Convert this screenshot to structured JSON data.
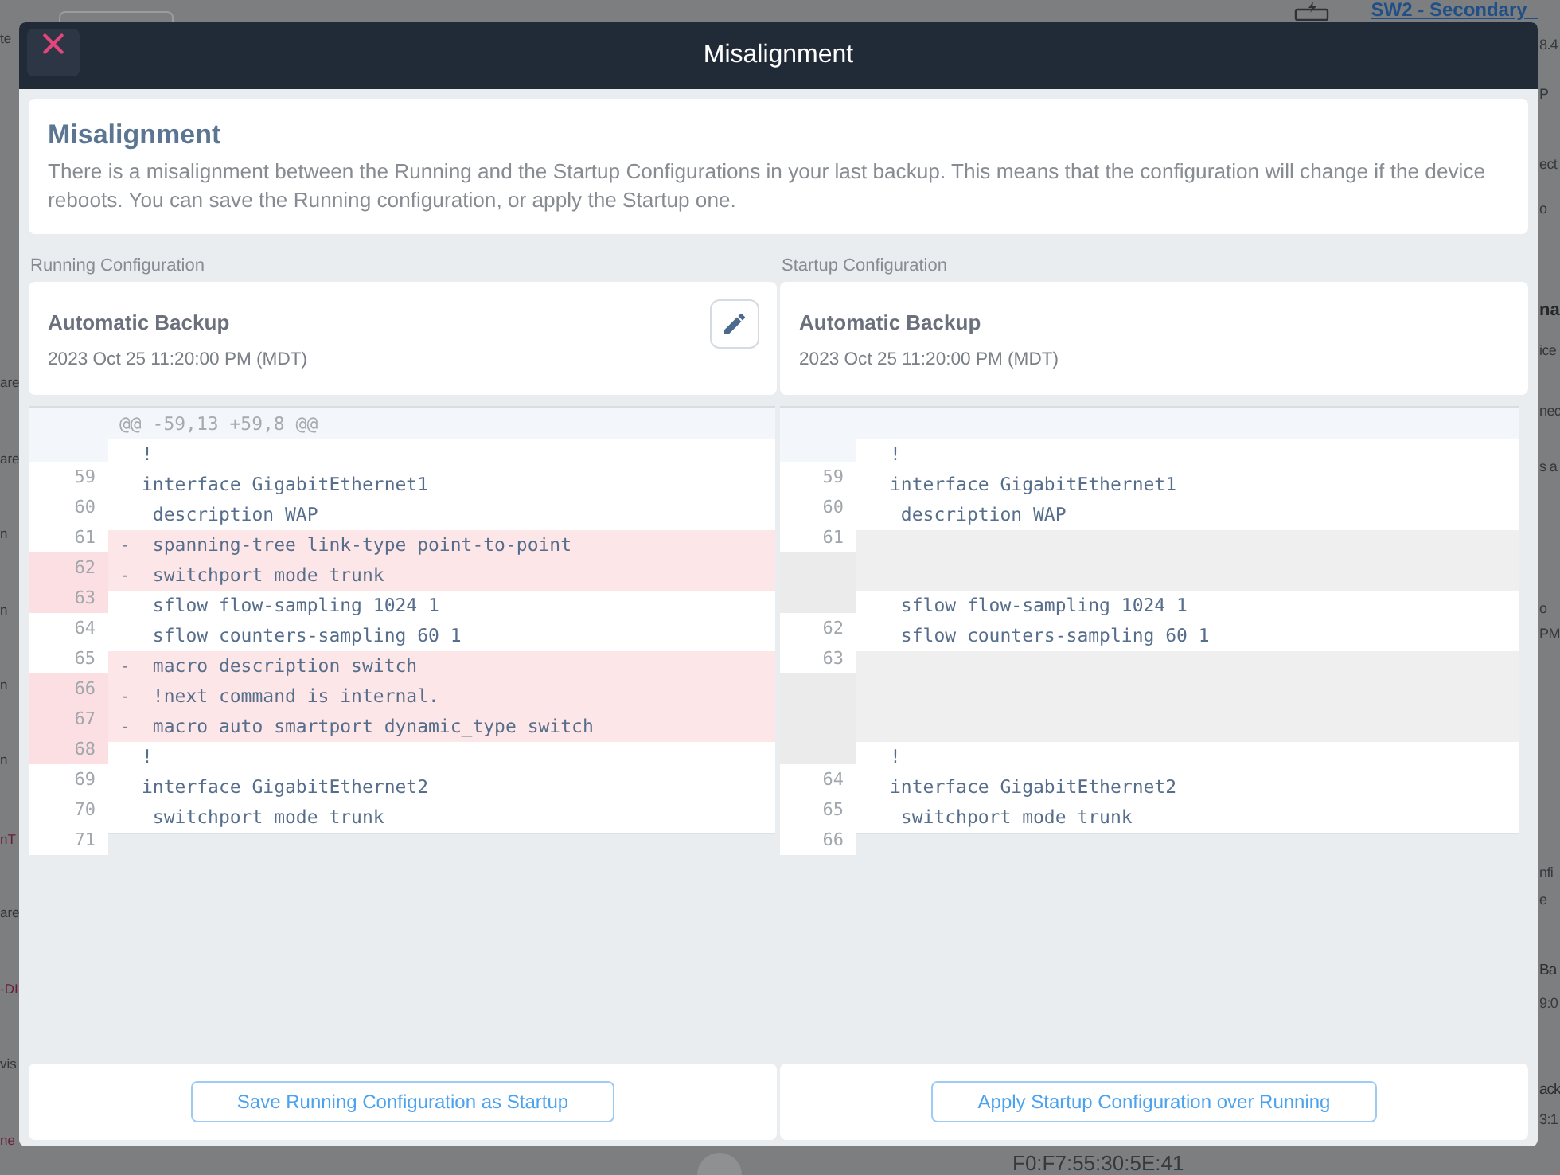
{
  "background": {
    "left_fragments": [
      {
        "text": "te",
        "color": "#333537"
      },
      {
        "text": "are",
        "color": "#333537"
      },
      {
        "text": "are",
        "color": "#333537"
      },
      {
        "text": "n",
        "color": "#333537"
      },
      {
        "text": "n",
        "color": "#333537"
      },
      {
        "text": "n",
        "color": "#333537"
      },
      {
        "text": "n",
        "color": "#333537"
      },
      {
        "text": "nT",
        "color": "#6b1c3c"
      },
      {
        "text": "are",
        "color": "#333537"
      },
      {
        "text": "-DI",
        "color": "#6b1c3c"
      },
      {
        "text": "vis",
        "color": "#333537"
      },
      {
        "text": "ne",
        "color": "#6b1c3c"
      }
    ],
    "link": "SW2 - Secondary_",
    "right_fragments": [
      {
        "text": "8.4",
        "kind": "text"
      },
      {
        "text": "P",
        "kind": "text"
      },
      {
        "text": "ect",
        "kind": "text"
      },
      {
        "text": "o",
        "kind": "text"
      },
      {
        "text": "na",
        "kind": "title"
      },
      {
        "text": "ice",
        "kind": "text"
      },
      {
        "text": "nec",
        "kind": "text"
      },
      {
        "text": "s a",
        "kind": "text"
      },
      {
        "text": "o",
        "kind": "text"
      },
      {
        "text": "PM",
        "kind": "text"
      },
      {
        "text": "nfi",
        "kind": "text"
      },
      {
        "text": "e",
        "kind": "text"
      },
      {
        "text": "Ba",
        "kind": "label"
      },
      {
        "text": "9:0",
        "kind": "text"
      },
      {
        "text": "ack",
        "kind": "label"
      },
      {
        "text": "3:1",
        "kind": "text"
      }
    ],
    "bottom_text": "F0:F7:55:30:5E:41"
  },
  "dialog": {
    "title": "Misalignment"
  },
  "notice": {
    "heading": "Misalignment",
    "text": "There is a misalignment between the Running and the Startup Configurations in your last backup. This means that the configuration will change if the device reboots. You can save the Running configuration, or apply the Startup one."
  },
  "panes": [
    {
      "label": "Running Configuration",
      "backup": {
        "title": "Automatic Backup",
        "date": "2023 Oct 25 11:20:00 PM (MDT)"
      },
      "editable": true,
      "hunk": "@@ -59,13 +59,8 @@",
      "lines": [
        {
          "number": "59",
          "text": "!",
          "kind": "context"
        },
        {
          "number": "60",
          "text": "interface GigabitEthernet1",
          "kind": "context"
        },
        {
          "number": "61",
          "text": " description WAP",
          "kind": "context"
        },
        {
          "number": "62",
          "marker": "-",
          "text": " spanning-tree link-type point-to-point",
          "kind": "removed"
        },
        {
          "number": "63",
          "marker": "-",
          "text": " switchport mode trunk",
          "kind": "removed"
        },
        {
          "number": "64",
          "text": " sflow flow-sampling 1024 1",
          "kind": "context"
        },
        {
          "number": "65",
          "text": " sflow counters-sampling 60 1",
          "kind": "context"
        },
        {
          "number": "66",
          "marker": "-",
          "text": " macro description switch",
          "kind": "removed"
        },
        {
          "number": "67",
          "marker": "-",
          "text": " !next command is internal.",
          "kind": "removed"
        },
        {
          "number": "68",
          "marker": "-",
          "text": " macro auto smartport dynamic_type switch",
          "kind": "removed"
        },
        {
          "number": "69",
          "text": "!",
          "kind": "context"
        },
        {
          "number": "70",
          "text": "interface GigabitEthernet2",
          "kind": "context"
        },
        {
          "number": "71",
          "text": " switchport mode trunk",
          "kind": "context"
        }
      ],
      "action": "Save Running Configuration as Startup"
    },
    {
      "label": "Startup Configuration",
      "backup": {
        "title": "Automatic Backup",
        "date": "2023 Oct 25 11:20:00 PM (MDT)"
      },
      "editable": false,
      "lines": [
        {
          "number": "59",
          "text": "!",
          "kind": "context"
        },
        {
          "number": "60",
          "text": "interface GigabitEthernet1",
          "kind": "context"
        },
        {
          "number": "61",
          "text": " description WAP",
          "kind": "context"
        },
        {
          "kind": "empty"
        },
        {
          "kind": "empty"
        },
        {
          "number": "62",
          "text": " sflow flow-sampling 1024 1",
          "kind": "context"
        },
        {
          "number": "63",
          "text": " sflow counters-sampling 60 1",
          "kind": "context"
        },
        {
          "kind": "empty"
        },
        {
          "kind": "empty"
        },
        {
          "kind": "empty"
        },
        {
          "number": "64",
          "text": "!",
          "kind": "context"
        },
        {
          "number": "65",
          "text": "interface GigabitEthernet2",
          "kind": "context"
        },
        {
          "number": "66",
          "text": " switchport mode trunk",
          "kind": "context"
        }
      ],
      "action": "Apply Startup Configuration over Running"
    }
  ]
}
